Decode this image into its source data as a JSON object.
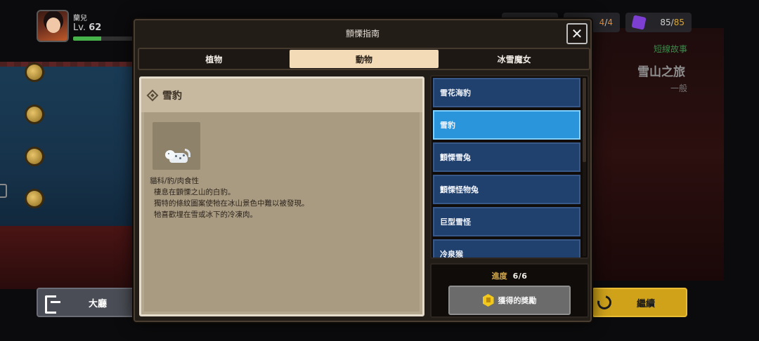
{
  "player": {
    "name": "蘭兒",
    "level_label": "Lv.",
    "level": "62",
    "exp_fraction": 0.42
  },
  "hud": {
    "tickets_current": "4",
    "tickets_max": "4",
    "puzzle_current": "85",
    "puzzle_max": "85",
    "separator": "/"
  },
  "story": {
    "kind": "短線故事",
    "title": "雪山之旅",
    "difficulty": "一般"
  },
  "bottom": {
    "lobby_label": "大廳",
    "continue_label": "繼續"
  },
  "modal": {
    "title": "顫慄指南",
    "close_label": "✕",
    "tabs": [
      {
        "label": "植物",
        "active": false
      },
      {
        "label": "動物",
        "active": true
      },
      {
        "label": "冰雪魔女",
        "active": false
      }
    ],
    "detail": {
      "name": "雪豹",
      "lines": [
        "貓科/豹/肉食性",
        "棲息在顫慄之山的白豹。",
        "獨特的條紋圖案使牠在冰山景色中難以被發現。",
        "牠喜歡埋在雪或冰下的冷凍肉。"
      ]
    },
    "list": [
      {
        "label": "雪花海豹",
        "selected": false
      },
      {
        "label": "雪豹",
        "selected": true
      },
      {
        "label": "顫慄雪兔",
        "selected": false
      },
      {
        "label": "顫慄怪物兔",
        "selected": false
      },
      {
        "label": "巨型雪怪",
        "selected": false
      },
      {
        "label": "冷泉猴",
        "selected": false
      }
    ],
    "progress": {
      "label": "進度",
      "current": "6",
      "total": "6"
    },
    "reward_label": "獲得的獎勵"
  },
  "colors": {
    "selected_item": "#2a95db",
    "list_item": "#20406e",
    "active_tab": "#f4dbb8",
    "continue_button": "#cfa21a",
    "progress_label": "#d4aa50"
  }
}
